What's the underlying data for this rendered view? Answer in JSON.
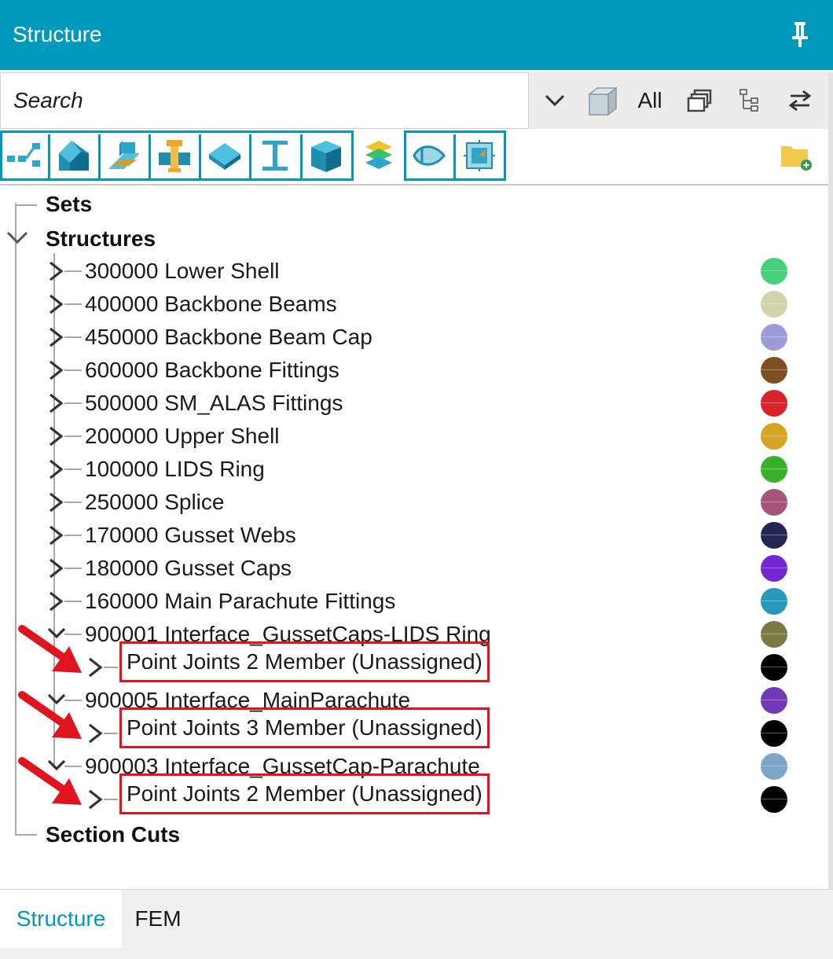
{
  "panel": {
    "title": "Structure"
  },
  "search": {
    "placeholder": "Search",
    "filter_all_label": "All"
  },
  "tree": {
    "groups": [
      {
        "label": "Sets"
      },
      {
        "label": "Structures"
      },
      {
        "label": "Section Cuts"
      }
    ],
    "structures": [
      {
        "label": "300000 Lower Shell",
        "color": "#46D07E",
        "expanded": false
      },
      {
        "label": "400000 Backbone Beams",
        "color": "#D3D3AC",
        "expanded": false
      },
      {
        "label": "450000 Backbone Beam Cap",
        "color": "#9D9CD6",
        "expanded": false
      },
      {
        "label": "600000 Backbone Fittings",
        "color": "#7E4F22",
        "expanded": false
      },
      {
        "label": "500000 SM_ALAS Fittings",
        "color": "#D9232A",
        "expanded": false
      },
      {
        "label": "200000 Upper Shell",
        "color": "#D6A525",
        "expanded": false
      },
      {
        "label": "100000 LIDS Ring",
        "color": "#38B029",
        "expanded": false
      },
      {
        "label": "250000 Splice",
        "color": "#A8557C",
        "expanded": false
      },
      {
        "label": "170000 Gusset Webs",
        "color": "#262652",
        "expanded": false
      },
      {
        "label": "180000 Gusset Caps",
        "color": "#7425D4",
        "expanded": false
      },
      {
        "label": "160000 Main Parachute Fittings",
        "color": "#2798B7",
        "expanded": false
      },
      {
        "label": "900001 Interface_GussetCaps-LIDS Ring",
        "color": "#7B7A45",
        "expanded": true,
        "child": {
          "label": "Point Joints 2 Member (Unassigned)",
          "color": "#000000"
        }
      },
      {
        "label": "900005 Interface_MainParachute",
        "color": "#7239B6",
        "expanded": true,
        "child": {
          "label": "Point Joints 3 Member (Unassigned)",
          "color": "#000000"
        }
      },
      {
        "label": "900003 Interface_GussetCap-Parachute",
        "color": "#7BA6C5",
        "expanded": true,
        "child": {
          "label": "Point Joints 2 Member (Unassigned)",
          "color": "#000000"
        }
      }
    ]
  },
  "tabs": [
    {
      "label": "Structure",
      "active": true
    },
    {
      "label": "FEM",
      "active": false
    }
  ],
  "colors": {
    "accent": "#0099BC",
    "highlight": "#E0141E",
    "arrow": "#E0141E"
  },
  "icons": {
    "header": [
      "pin-icon"
    ],
    "search_row": [
      "chevron-down-icon",
      "cube-icon",
      "copy-windows-icon",
      "hierarchy-icon",
      "swap-arrows-icon"
    ],
    "toolbar": [
      "line-icon",
      "shell-icon",
      "beam-icon",
      "fastener-icon",
      "plate-icon",
      "i-beam-icon",
      "solid-icon",
      "layers-icon",
      "rivet-icon",
      "bolt-frame-icon",
      "add-folder-icon"
    ]
  }
}
